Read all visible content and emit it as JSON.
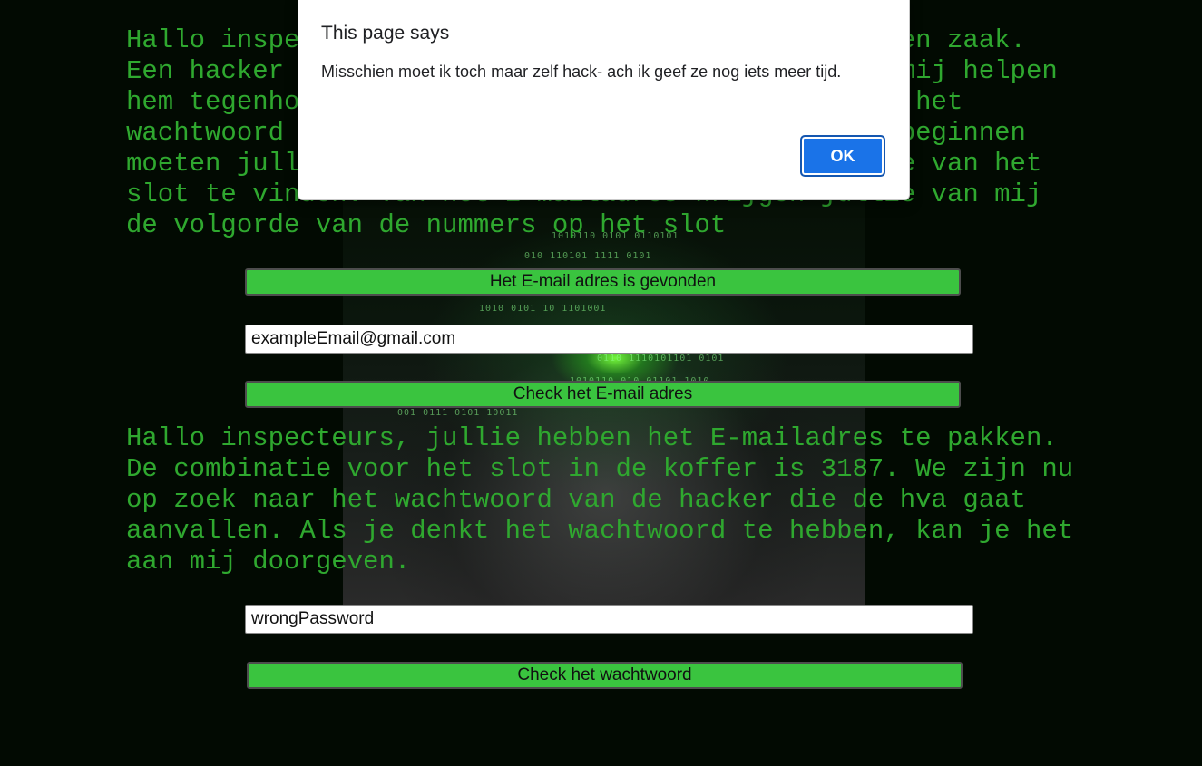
{
  "story": {
    "intro": "Hallo inspecteurs, jullie moeten mij helpen met een zaak. Een hacker wil de hva aanvallen en jullie moeten mij helpen hem tegenhouden. Jullie moeten het E-mailadres en het wachtwoord van de hacker, voor mij vinden. Om te beginnen moeten jullie van deze koffer helpen de combinatie van het slot te vinden. Van het E-mailadres krijgen jullie van mij de volgorde van de nummers op het slot",
    "followup": "Hallo inspecteurs, jullie hebben het E-mailadres te pakken. De combinatie voor het slot in de koffer is 3187. We zijn nu op zoek naar het wachtwoord van de hacker die de hva gaat aanvallen. Als je denkt het wachtwoord te hebben, kan je het aan mij doorgeven."
  },
  "email": {
    "found_label": "Het E-mail adres is gevonden",
    "value": "exampleEmail@gmail.com",
    "check_label": "Check het E-mail adres"
  },
  "password": {
    "value": "wrongPassword",
    "check_label": "Check het wachtwoord"
  },
  "dialog": {
    "title": "This page says",
    "message": "Misschien moet ik toch maar zelf hack- ach ik geef ze nog iets meer tijd.",
    "ok_label": "OK"
  },
  "background": {
    "image": "hacker-hooded-figure-icon",
    "code_lines": [
      "1010110 0101 0110101",
      "010 110101 1111 0101",
      "1010 0101 10 1101001",
      "0110 1110101101 0101",
      "1010110 010 01101 1010",
      "001 0111 0101 10011"
    ]
  },
  "colors": {
    "page_bg": "#020a02",
    "text_green": "#2fa82f",
    "button_green": "#3ac43f",
    "dialog_ok": "#1a73e8"
  }
}
